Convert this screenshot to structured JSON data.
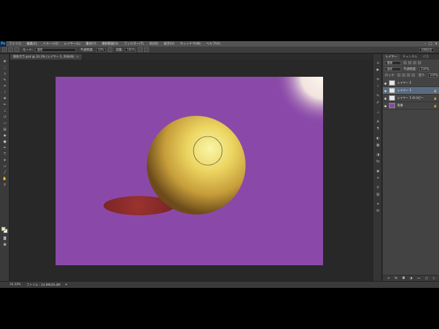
{
  "app": {
    "logo": "Ps",
    "menu": [
      "ファイル",
      "編集(E)",
      "イメージ(I)",
      "レイヤー(L)",
      "書式(Y)",
      "選択範囲(S)",
      "フィルター(T)",
      "3D(D)",
      "表示(V)",
      "ウィンドウ(W)",
      "ヘルプ(H)"
    ],
    "window_controls": [
      "–",
      "□",
      "×"
    ]
  },
  "options": {
    "mode_label": "モード:",
    "mode_value": "通常",
    "opacity_label": "不透明度:",
    "opacity_value": "10%",
    "flow_label": "流量:",
    "flow_value": "100%",
    "workspace": "初期設定"
  },
  "document": {
    "tab_title": "球体ガラ.psd @ 33.3% (レイヤー 1, RGB/8)",
    "tab_close": "×"
  },
  "status": {
    "zoom": "33.33%",
    "file_info": "ファイル : 24.9M/29.4M",
    "arrow": "▸"
  },
  "layers_panel": {
    "tabs": [
      "レイヤー",
      "チャンネル",
      "パス"
    ],
    "kind_filter": "種類",
    "blend_mode": "通常",
    "opacity_label": "不透明度:",
    "opacity_value": "100%",
    "lock_label": "ロック:",
    "fill_label": "塗り:",
    "fill_value": "100%",
    "layers": [
      {
        "name": "レイヤー 2",
        "thumb": "checker",
        "selected": false,
        "locked": false
      },
      {
        "name": "レイヤー 1",
        "thumb": "checker",
        "selected": true,
        "locked": true
      },
      {
        "name": "レイヤー 1 のコピー",
        "thumb": "checker",
        "selected": false,
        "locked": true
      },
      {
        "name": "背景",
        "thumb": "purple",
        "selected": false,
        "locked": true
      }
    ],
    "footer_icons": [
      "link-icon",
      "fx-icon",
      "mask-icon",
      "adjustment-icon",
      "folder-icon",
      "new-layer-icon",
      "trash-icon"
    ],
    "eye_glyph": "●",
    "lock_glyph": "🔒"
  },
  "canvas": {
    "background_color": "#8a49a8",
    "sphere_highlight": "#f6f3a0",
    "sphere_mid": "#d8b545",
    "sphere_shadow": "#6b4a1a",
    "cast_shadow_color": "#8a2b2a"
  }
}
